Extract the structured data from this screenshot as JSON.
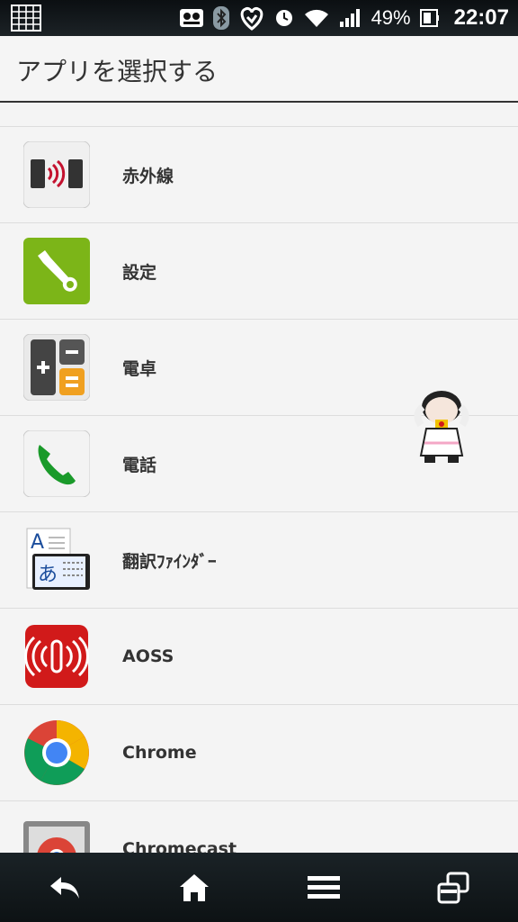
{
  "status_bar": {
    "battery_percent": "49%",
    "time": "22:07",
    "icons": [
      "grid-icon",
      "voicemail-icon",
      "bluetooth-icon",
      "heart-icon",
      "alarm-icon",
      "wifi-icon",
      "signal-icon",
      "battery-icon"
    ]
  },
  "header": {
    "title": "アプリを選択する"
  },
  "apps": [
    {
      "label": "赤外線",
      "icon": "infrared-icon"
    },
    {
      "label": "設定",
      "icon": "settings-wrench-icon"
    },
    {
      "label": "電卓",
      "icon": "calculator-icon"
    },
    {
      "label": "電話",
      "icon": "phone-icon"
    },
    {
      "label": "翻訳ﾌｧｲﾝﾀﾞｰ",
      "icon": "translate-finder-icon"
    },
    {
      "label": "AOSS",
      "icon": "aoss-icon"
    },
    {
      "label": "Chrome",
      "icon": "chrome-icon"
    },
    {
      "label": "Chromecast",
      "icon": "chromecast-icon"
    }
  ],
  "nav": [
    "back-icon",
    "home-icon",
    "menu-icon",
    "recents-icon"
  ]
}
